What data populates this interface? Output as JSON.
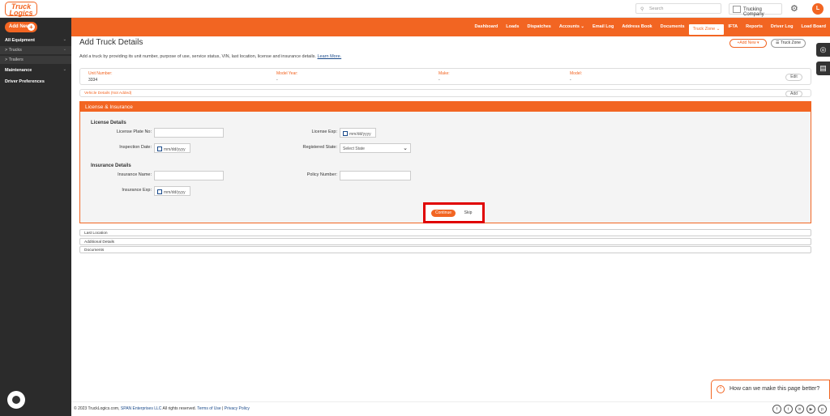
{
  "app": {
    "logo_text": "Truck Logics"
  },
  "topbar": {
    "search_placeholder": "Search",
    "company": "Trucking Company",
    "avatar_initial": "L"
  },
  "nav": {
    "items": [
      "Dashboard",
      "Loads",
      "Dispatches",
      "Accounts ⌄",
      "Email Log",
      "Address Book",
      "Documents",
      "Truck Zone ⌄",
      "IFTA",
      "Reports",
      "Driver Log",
      "Load Board"
    ],
    "active": "Truck Zone ⌄"
  },
  "sidebar": {
    "add_new": "Add New",
    "items": [
      {
        "label": "All Equipment"
      },
      {
        "label": "> Trucks"
      },
      {
        "label": "> Trailers"
      },
      {
        "label": "Maintenance"
      },
      {
        "label": "Driver Preferences"
      }
    ]
  },
  "page": {
    "title": "Add Truck Details",
    "subtitle": "Add a truck by providing its unit number, purpose of use, service status, VIN, last location, license and insurance details.",
    "learn_more": "Learn More.",
    "add_new_btn": "+Add New ▾",
    "truck_zone_btn": "☰ Truck Zone"
  },
  "unit_card": {
    "unit_number_label": "Unit Number:",
    "unit_number": "3334",
    "model_year_label": "Model Year:",
    "model_year": "-",
    "make_label": "Make:",
    "make": "-",
    "model_label": "Model:",
    "model": "-",
    "edit": "Edit"
  },
  "vehicle_details": {
    "label": "Vehicle Details (Not Added)",
    "add": "Add"
  },
  "license_insurance": {
    "header": "License & Insurance",
    "license_section": "License Details",
    "license_plate_label": "License Plate No:",
    "license_exp_label": "License Exp:",
    "license_exp_placeholder": "mm/dd/yyyy",
    "inspection_date_label": "Inspection Date:",
    "inspection_date_placeholder": "mm/dd/yyyy",
    "registered_state_label": "Registered State:",
    "registered_state_value": "Select State",
    "insurance_section": "Insurance Details",
    "insurance_name_label": "Insurance Name:",
    "policy_number_label": "Policy Number:",
    "insurance_exp_label": "Insurance Exp:",
    "insurance_exp_placeholder": "mm/dd/yyyy",
    "continue": "Continue",
    "skip": "Skip"
  },
  "accordions": [
    "Last Location",
    "Additional Details",
    "Documents"
  ],
  "footer": {
    "copyright": "© 2023 TruckLogics.com,",
    "span": "SPAN Enterprises LLC",
    "rights": "All rights reserved.",
    "terms": "Terms of Use",
    "sep": "|",
    "privacy": "Privacy Policy"
  },
  "feedback": {
    "text": "How can we make this page better?"
  }
}
